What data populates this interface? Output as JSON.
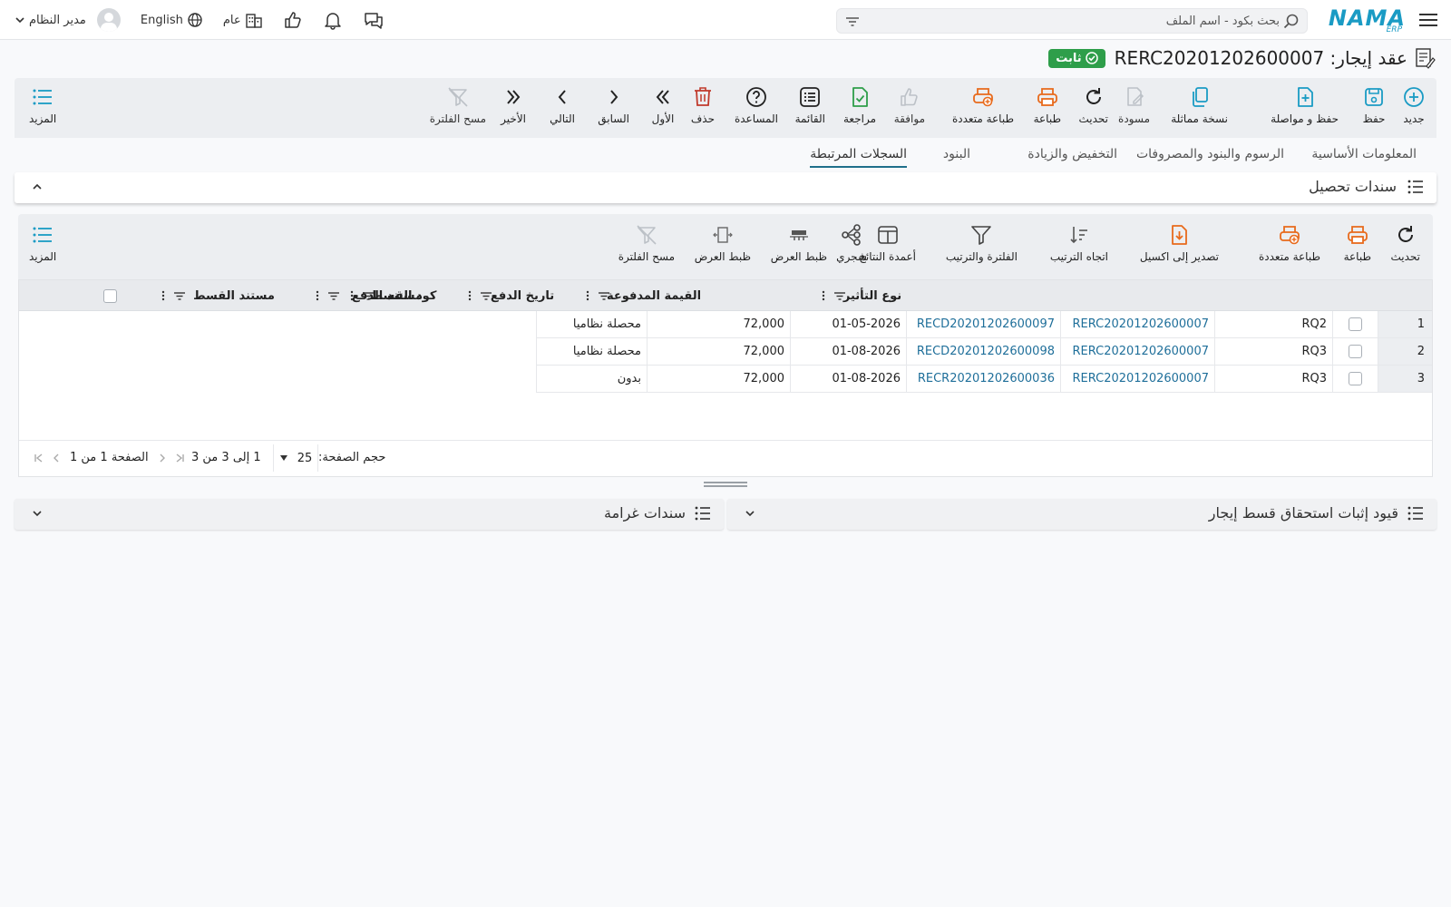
{
  "topbar": {
    "logo_text": "NAMA",
    "logo_sub": "ERP",
    "search_placeholder": "بحث بكود - اسم الملف",
    "branch_label": "عام",
    "language_label": "English",
    "user_label": "مدير النظام"
  },
  "header": {
    "title": "عقد إيجار: RERC20201202600007",
    "status": "ثابت"
  },
  "toolbar": {
    "items": [
      "جديد",
      "حفظ",
      "حفظ و مواصلة",
      "نسخة مماثلة",
      "مسودة",
      "تحديث",
      "طباعة",
      "طباعة متعددة",
      "موافقة",
      "مراجعة",
      "القائمة",
      "المساعدة",
      "حذف",
      "الأول",
      "السابق",
      "التالي",
      "الأخير",
      "مسح الفلترة"
    ],
    "more": "المزيد"
  },
  "tabs": [
    "المعلومات الأساسية",
    "الرسوم والبنود والمصروفات",
    "التخفيض والزيادة",
    "البنود",
    "السجلات المرتبطة"
  ],
  "panel": {
    "title": "سندات تحصيل"
  },
  "inner_toolbar": {
    "items": [
      "تحديث",
      "طباعة",
      "طباعة متعددة",
      "تصدير إلى اكسيل",
      "اتجاه الترتيب",
      "الفلترة والترتيب",
      "أعمدة النتائج",
      "شجري",
      "ظبط العرض",
      "ظبط العرض",
      "مسح الفلترة"
    ],
    "more": "المزيد"
  },
  "grid": {
    "columns": [
      "كود القسط",
      "مستند القسط",
      "مستند الدفع",
      "تاريخ الدفع",
      "القيمة المدفوعة",
      "نوع التأثير"
    ],
    "rows": [
      {
        "num": "1",
        "code": "RQ2",
        "installment_doc": "RERC20201202600007",
        "payment_doc": "RECD20201202600097",
        "date": "01-05-2026",
        "amount": "72,000",
        "effect": "محصلة نظاميا"
      },
      {
        "num": "2",
        "code": "RQ3",
        "installment_doc": "RERC20201202600007",
        "payment_doc": "RECD20201202600098",
        "date": "01-08-2026",
        "amount": "72,000",
        "effect": "محصلة نظاميا"
      },
      {
        "num": "3",
        "code": "RQ3",
        "installment_doc": "RERC20201202600007",
        "payment_doc": "RECR20201202600036",
        "date": "01-08-2026",
        "amount": "72,000",
        "effect": "بدون"
      }
    ],
    "page_size_label": "حجم الصفحة:",
    "page_size": "25",
    "range_text": "1 إلى 3 من 3",
    "page_text": "الصفحة 1 من 1"
  },
  "bottom_panels": {
    "right": "قيود إثبات استحقاق قسط إيجار",
    "left": "سندات غرامة"
  },
  "colors": {
    "accent": "#1a9bc4",
    "status_green": "#2e9e4a",
    "print_orange": "#e86a1c",
    "delete_red": "#c0392b"
  }
}
